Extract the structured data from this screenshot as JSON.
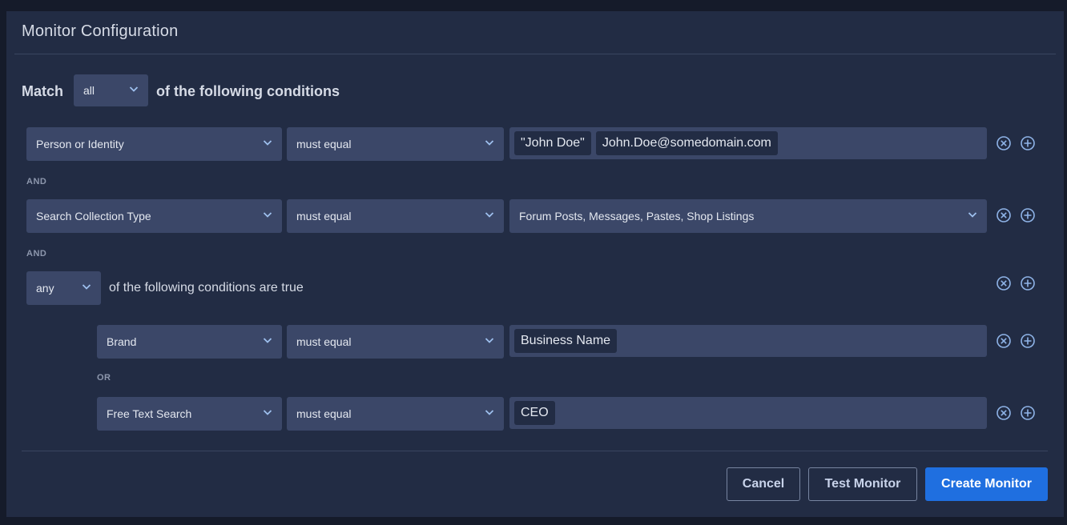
{
  "header": {
    "title": "Monitor Configuration"
  },
  "match": {
    "label": "Match",
    "mode": "all",
    "suffix": "of the following conditions"
  },
  "conditions": [
    {
      "field": "Person or Identity",
      "operator": "must equal",
      "tags": [
        "\"John Doe\"",
        "John.Doe@somedomain.com"
      ]
    },
    {
      "field": "Search Collection Type",
      "operator": "must equal",
      "value": "Forum Posts, Messages, Pastes, Shop Listings"
    }
  ],
  "joins": {
    "and1": "AND",
    "and2": "AND",
    "or1": "OR"
  },
  "group": {
    "mode": "any",
    "suffix": "of the following conditions are true",
    "conditions": [
      {
        "field": "Brand",
        "operator": "must equal",
        "tags": [
          "Business Name"
        ]
      },
      {
        "field": "Free Text Search",
        "operator": "must equal",
        "tags": [
          "CEO"
        ]
      }
    ]
  },
  "footer": {
    "cancel_label": "Cancel",
    "test_label": "Test Monitor",
    "create_label": "Create Monitor"
  },
  "icons": {
    "remove": "close-circle-icon",
    "add": "plus-circle-icon",
    "dropdown": "chevron-down-icon"
  },
  "colors": {
    "panel": "#222c44",
    "control": "#3b4768",
    "primary": "#1f6fe0",
    "icon": "#8fb4e8"
  }
}
